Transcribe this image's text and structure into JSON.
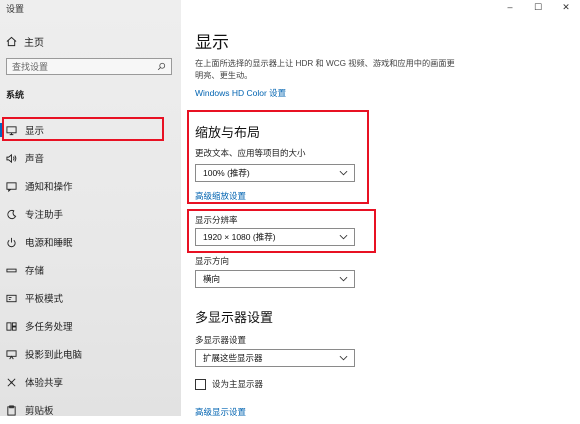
{
  "window": {
    "title": "设置",
    "controls": [
      "–",
      "☐",
      "✕"
    ]
  },
  "sidebar": {
    "home_label": "主页",
    "search_placeholder": "查找设置",
    "section_label": "系统",
    "items": [
      {
        "label": "显示",
        "icon": "monitor-icon",
        "active": true
      },
      {
        "label": "声音",
        "icon": "speaker-icon"
      },
      {
        "label": "通知和操作",
        "icon": "notification-icon"
      },
      {
        "label": "专注助手",
        "icon": "moon-icon"
      },
      {
        "label": "电源和睡眠",
        "icon": "power-icon"
      },
      {
        "label": "存储",
        "icon": "storage-icon"
      },
      {
        "label": "平板模式",
        "icon": "tablet-icon"
      },
      {
        "label": "多任务处理",
        "icon": "multitask-icon"
      },
      {
        "label": "投影到此电脑",
        "icon": "project-icon"
      },
      {
        "label": "体验共享",
        "icon": "share-icon"
      },
      {
        "label": "剪贴板",
        "icon": "clipboard-icon"
      }
    ]
  },
  "main": {
    "title": "显示",
    "description": "在上面所选择的显示器上让 HDR 和 WCG 视频、游戏和应用中的画面更明亮、更生动。",
    "hdr_link": "Windows HD Color 设置",
    "scale": {
      "heading": "缩放与布局",
      "label": "更改文本、应用等项目的大小",
      "value": "100% (推荐)",
      "advanced_link": "高级缩放设置"
    },
    "resolution": {
      "label": "显示分辨率",
      "value": "1920 × 1080 (推荐)"
    },
    "orientation": {
      "label": "显示方向",
      "value": "横向"
    },
    "multi": {
      "heading": "多显示器设置",
      "label": "多显示器设置",
      "value": "扩展这些显示器",
      "checkbox_label": "设为主显示器",
      "checkbox_checked": false,
      "advanced_link": "高级显示设置"
    }
  },
  "colors": {
    "accent": "#0063b1",
    "highlight": "#e81123",
    "sidebar_bg": "#eeeeee"
  }
}
